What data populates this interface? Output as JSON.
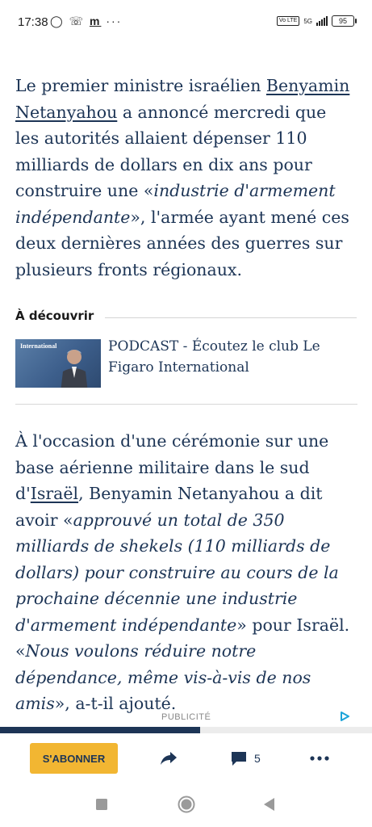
{
  "status_bar": {
    "time": "17:38",
    "left_icons": [
      "whatsapp-icon",
      "missed-call-icon",
      "m-app-icon",
      "more-dots-icon"
    ],
    "network": "5G",
    "volte": "Vo LTE",
    "battery": "95"
  },
  "article": {
    "para1": {
      "t1": "Le premier ministre israélien ",
      "link": "Benyamin Netanyahou",
      "t2": " a annoncé mercredi que les autorités allaient dépenser 110 milliards de dollars en dix ans pour construire une «",
      "em": "industrie d'armement indépendante",
      "t3": "», l'armée ayant mené ces deux dernières années des guerres sur plusieurs fronts régionaux."
    },
    "discover": {
      "heading": "À découvrir",
      "thumb_label": "International",
      "title": "PODCAST - Écoutez le club Le Figaro International"
    },
    "para2": {
      "t1": "À l'occasion d'une cérémonie sur une base aérienne militaire dans le sud d'",
      "link": "Israël",
      "t2": ", Benyamin Netanyahou a dit avoir «",
      "em1": "approuvé un total de 350 milliards de shekels (110 milliards de dollars) pour construire au cours de la prochaine décennie une industrie d'armement indépendante",
      "t3": "» pour Israël. «",
      "em2": "Nous voulons réduire notre dépendance, même vis-à-vis de nos amis",
      "t4": "», a-t-il ajouté."
    }
  },
  "ad": {
    "label": "PUBLICITÉ"
  },
  "toolbar": {
    "subscribe_label": "S'ABONNER",
    "comment_count": "5"
  },
  "colors": {
    "text_navy": "#1d3556",
    "subscribe_yellow": "#f2b632"
  }
}
